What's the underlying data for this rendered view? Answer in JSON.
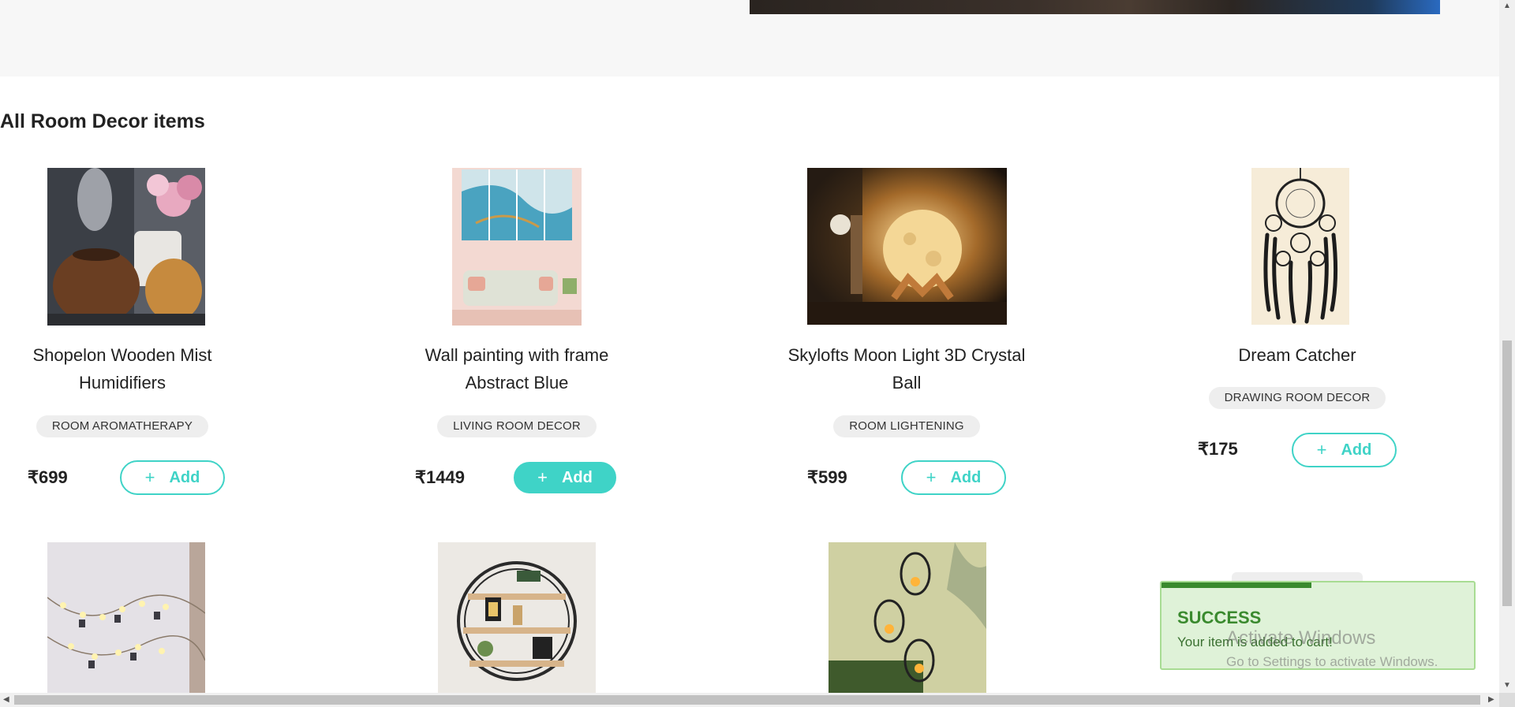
{
  "section_title": "All Room Decor items",
  "products": [
    {
      "name": "Shopelon Wooden Mist Humidifiers",
      "category": "ROOM AROMATHERAPY",
      "price": "₹699",
      "add_label": "Add",
      "add_icon": "plus-icon"
    },
    {
      "name": "Wall painting with frame Abstract Blue",
      "category": "LIVING ROOM DECOR",
      "price": "₹1449",
      "add_label": "Add",
      "add_icon": "plus-icon"
    },
    {
      "name": "Skylofts Moon Light 3D Crystal Ball",
      "category": "ROOM LIGHTENING",
      "price": "₹599",
      "add_label": "Add",
      "add_icon": "plus-icon"
    },
    {
      "name": "Dream Catcher",
      "category": "DRAWING ROOM DECOR",
      "price": "₹175",
      "add_label": "Add",
      "add_icon": "plus-icon"
    }
  ],
  "toast": {
    "title": "SUCCESS",
    "message": "Your item is added to cart!",
    "progress": 0.48
  },
  "watermark": {
    "title": "Activate Windows",
    "subtitle": "Go to Settings to activate Windows."
  },
  "colors": {
    "accent": "#3fd3c7",
    "success": "#3a8a2e",
    "success_bg": "#dff2d8"
  }
}
